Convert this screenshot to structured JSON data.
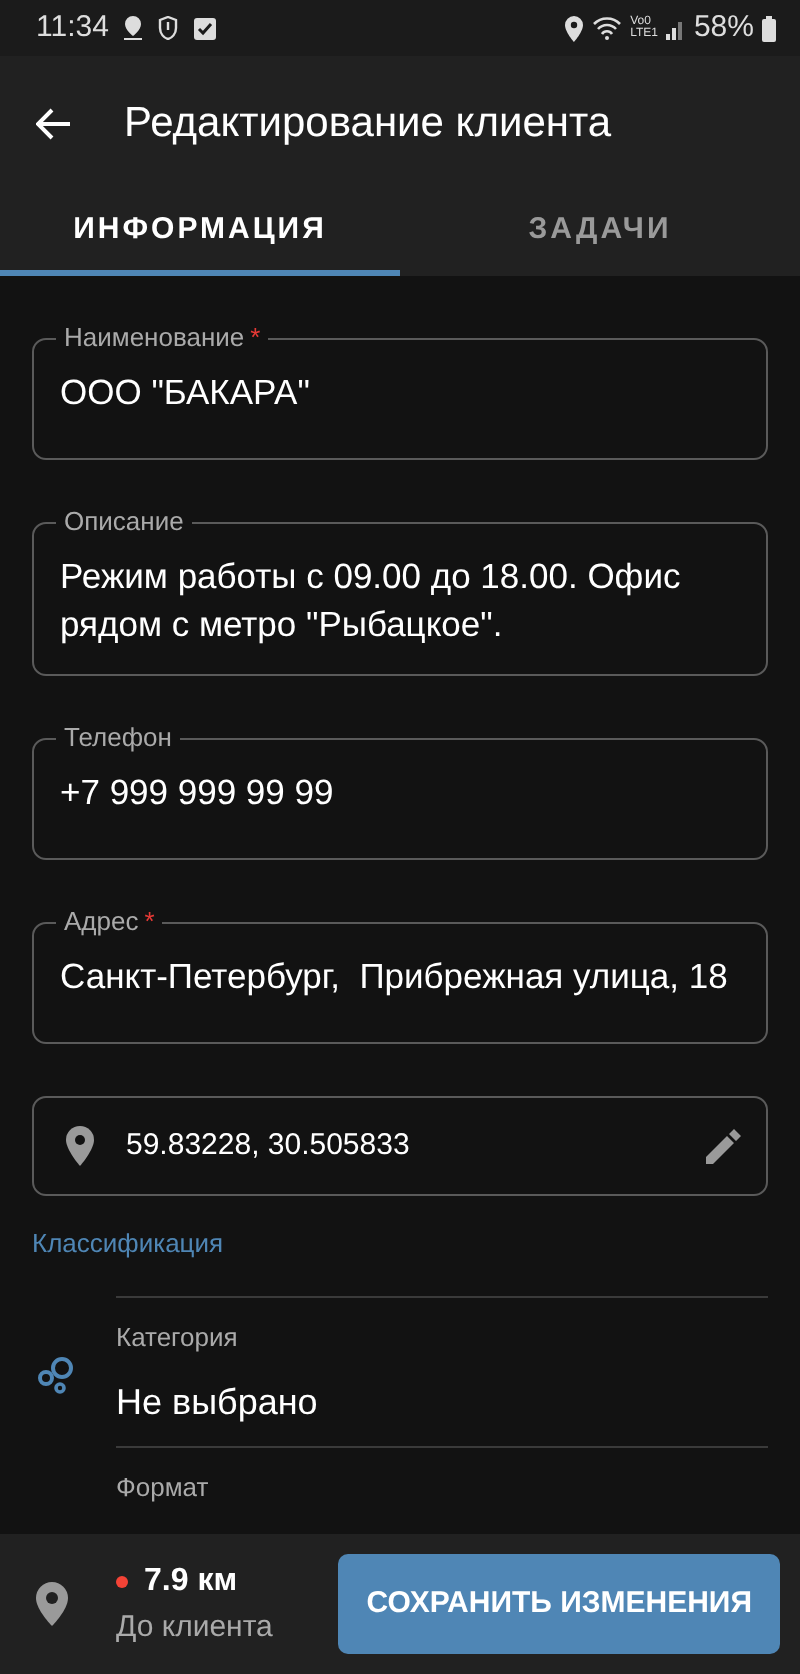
{
  "status_bar": {
    "time": "11:34",
    "network_top": "Vo0",
    "network_bottom": "LTE1",
    "battery": "58%"
  },
  "app_bar": {
    "title": "Редактирование клиента"
  },
  "tabs": [
    {
      "label": "ИНФОРМАЦИЯ",
      "selected": true
    },
    {
      "label": "ЗАДАЧИ",
      "selected": false
    }
  ],
  "fields": [
    {
      "label": "Наименование",
      "required_mark": "*",
      "value": "ООО \"БАКАРА\""
    },
    {
      "label": "Описание",
      "value": "Режим работы с 09.00 до 18.00. Офис рядом с метро \"Рыбацкое\"."
    },
    {
      "label": "Телефон",
      "value": "+7 999 999 99 99"
    },
    {
      "label": "Адрес",
      "required_mark": "*",
      "value": "Санкт-Петербург,  Прибрежная улица, 18"
    }
  ],
  "coordinates": {
    "value": "59.83228, 30.505833"
  },
  "classification": {
    "heading": "Классификация",
    "items": [
      {
        "label": "Категория",
        "value": "Не выбрано"
      },
      {
        "label": "Формат"
      }
    ]
  },
  "bottom_bar": {
    "distance": "7.9 км",
    "distance_label": "До клиента",
    "save_button": "СОХРАНИТЬ ИЗМЕНЕНИЯ"
  }
}
